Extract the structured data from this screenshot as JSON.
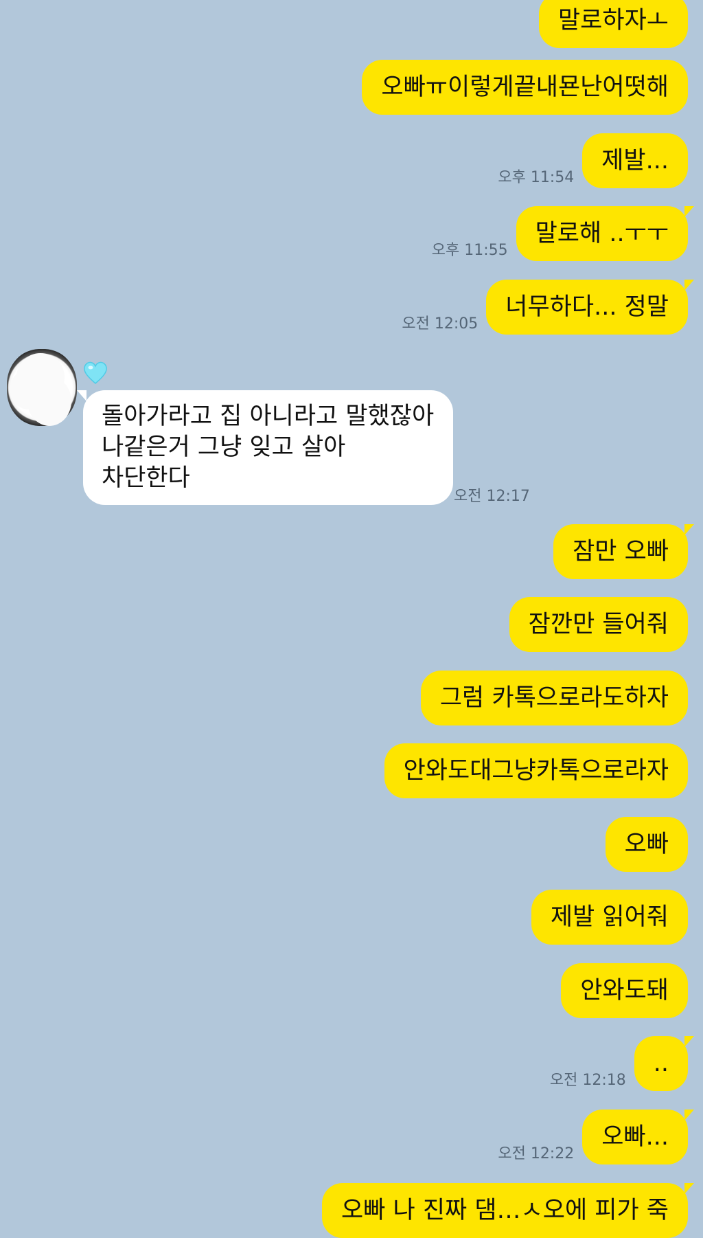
{
  "messages": [
    {
      "text": "말로하자ㅗ",
      "time": ""
    },
    {
      "text": "오빠ㅠ이렇게끝내묜난어떳해",
      "time": ""
    },
    {
      "text": "제발...",
      "time": "오후 11:54"
    },
    {
      "text": "말로해 ..ㅜㅜ",
      "time": "오후 11:55"
    },
    {
      "text": "너무하다... 정말",
      "time": "오전 12:05"
    },
    {
      "text": "잠만 오빠",
      "time": ""
    },
    {
      "text": "잠깐만 들어줘",
      "time": ""
    },
    {
      "text": "그럼 카톡으로라도하자",
      "time": ""
    },
    {
      "text": "안와도대그냥카톡으로라자",
      "time": ""
    },
    {
      "text": "오빠",
      "time": ""
    },
    {
      "text": "제발 읽어줘",
      "time": ""
    },
    {
      "text": "안와도돼",
      "time": ""
    },
    {
      "text": "..",
      "time": "오전 12:18"
    },
    {
      "text": "오빠...",
      "time": "오전 12:22"
    },
    {
      "text": "오빠 나 진짜 댐…ㅅ오에 피가 죽",
      "time": ""
    }
  ],
  "received": {
    "text": "돌아가라고 집 아니라고 말했잖아\n나같은거 그냥 잊고 살아\n차단한다",
    "time": "오전 12:17"
  },
  "colors": {
    "background": "#b2c7da",
    "sent_bubble": "#fee500",
    "received_bubble": "#ffffff",
    "heart": "#7fe3f5"
  }
}
